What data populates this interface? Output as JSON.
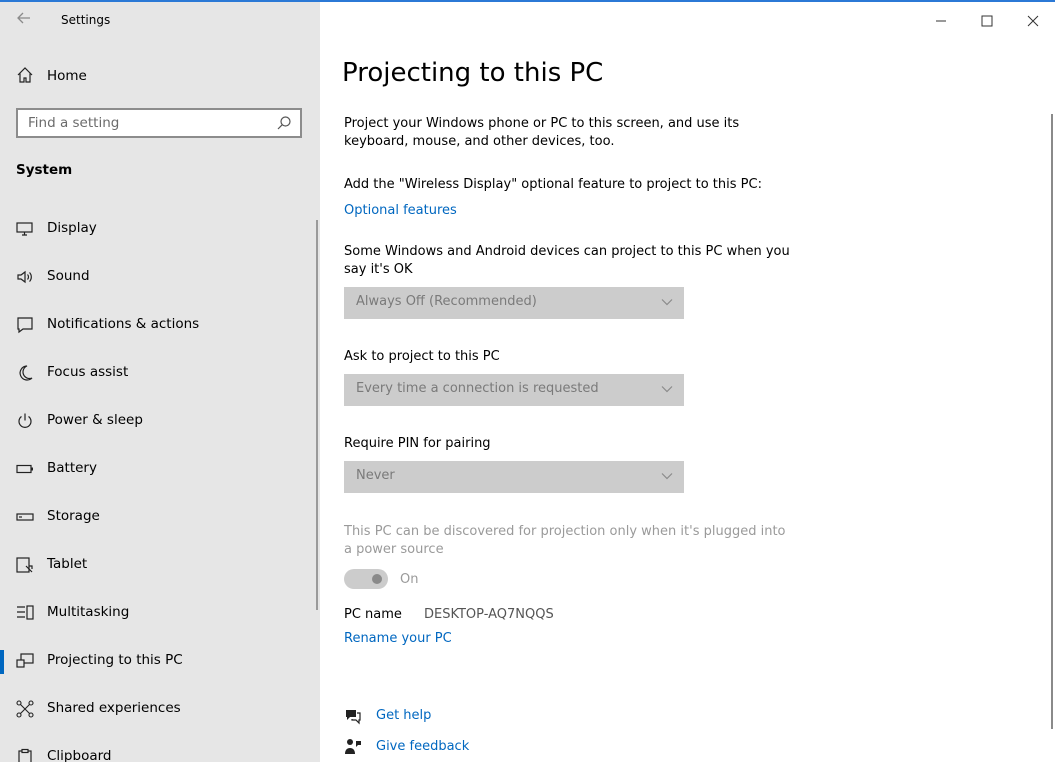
{
  "app": {
    "title": "Settings"
  },
  "sidebar": {
    "home_label": "Home",
    "search_placeholder": "Find a setting",
    "section_label": "System",
    "items": [
      {
        "label": "Display",
        "icon": "monitor-icon"
      },
      {
        "label": "Sound",
        "icon": "speaker-icon"
      },
      {
        "label": "Notifications & actions",
        "icon": "notification-icon"
      },
      {
        "label": "Focus assist",
        "icon": "moon-icon"
      },
      {
        "label": "Power & sleep",
        "icon": "power-icon"
      },
      {
        "label": "Battery",
        "icon": "battery-icon"
      },
      {
        "label": "Storage",
        "icon": "storage-icon"
      },
      {
        "label": "Tablet",
        "icon": "tablet-icon"
      },
      {
        "label": "Multitasking",
        "icon": "multitasking-icon"
      },
      {
        "label": "Projecting to this PC",
        "icon": "projecting-icon",
        "active": true
      },
      {
        "label": "Shared experiences",
        "icon": "shared-icon"
      },
      {
        "label": "Clipboard",
        "icon": "clipboard-icon"
      }
    ]
  },
  "main": {
    "title": "Projecting to this PC",
    "intro": "Project your Windows phone or PC to this screen, and use its keyboard, mouse, and other devices, too.",
    "wireless_text": "Add the \"Wireless Display\" optional feature to project to this PC:",
    "optional_features_link": "Optional features",
    "devices_text": "Some Windows and Android devices can project to this PC when you say it's OK",
    "devices_value": "Always Off (Recommended)",
    "ask_label": "Ask to project to this PC",
    "ask_value": "Every time a connection is requested",
    "pin_label": "Require PIN for pairing",
    "pin_value": "Never",
    "discover_text": "This PC can be discovered for projection only when it's plugged into a power source",
    "toggle_label": "On",
    "pc_name_label": "PC name",
    "pc_name_value": "DESKTOP-AQ7NQQS",
    "rename_link": "Rename your PC",
    "get_help": "Get help",
    "give_feedback": "Give feedback"
  },
  "colors": {
    "accent": "#0067c0",
    "sidebar_bg": "#e6e6e6",
    "dropdown_bg": "#cccccc"
  }
}
